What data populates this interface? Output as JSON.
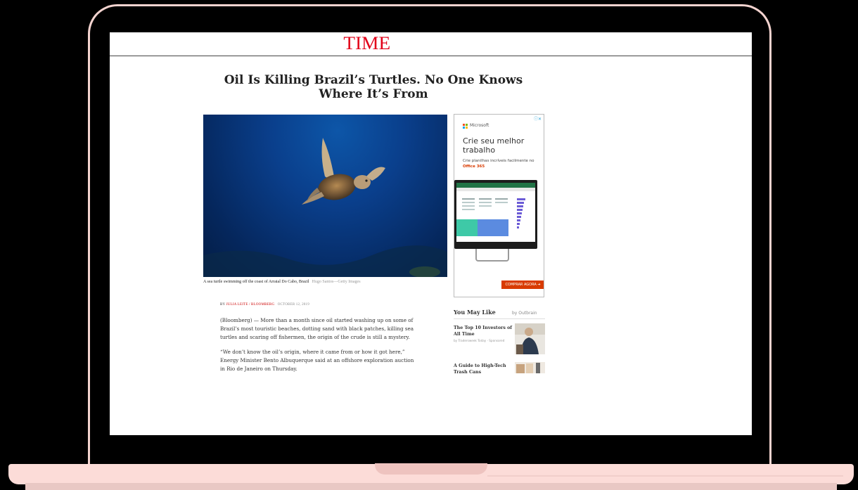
{
  "colors": {
    "brand": "#e2001a",
    "laptop_frame": "#f3d3cf",
    "cta": "#d83b01"
  },
  "header": {
    "logo": "TIME"
  },
  "article": {
    "headline": "Oil Is Killing Brazil’s Turtles. No One Knows Where It’s From",
    "image_caption": "A sea turtle swimming off the coast of Arraial Do Cabo, Brazil",
    "image_credit": "Hugo Santos—Getty Images",
    "byline_prefix": "BY",
    "author": "JULIA LEITE / BLOOMBERG",
    "date": "OCTOBER 12, 2019",
    "paragraphs": [
      "(Bloomberg) — More than a month since oil started washing up on some of Brazil’s most touristic beaches, dotting sand with black patches, killing sea turtles and scaring off fishermen, the origin of the crude is still a mystery.",
      "“We don’t know the oil’s origin, where it came from or how it got here,” Energy Minister Bento Albuquerque said at an offshore exploration auction in Rio de Janeiro on Thursday."
    ]
  },
  "ad": {
    "choices_icon": "adchoices-icon",
    "brand": "Microsoft",
    "title": "Crie seu melhor trabalho",
    "subtitle_prefix": "Crie planilhas incríveis facilmente no",
    "subtitle_highlight": "Office 365",
    "cta": "COMPRAR AGORA  ➔"
  },
  "recommendations": {
    "heading": "You May Like",
    "provider": "by Outbrain",
    "items": [
      {
        "title": "The Top 10 Investors of All Time",
        "source": "by Tradersweek Today · Sponsored"
      },
      {
        "title": "A Guide to High-Tech Trash Cans",
        "source": ""
      }
    ]
  }
}
